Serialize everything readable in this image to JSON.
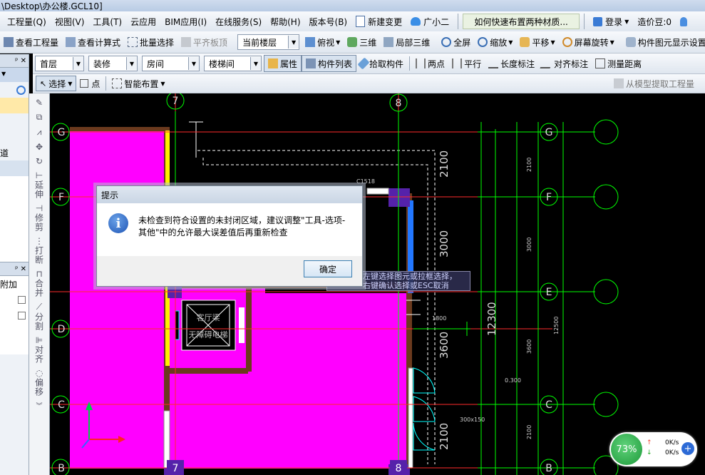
{
  "title_bar": {
    "path": "\\Desktop\\办公楼.GCL10]"
  },
  "menu": {
    "items": [
      "工程量(Q)",
      "视图(V)",
      "工具(T)",
      "云应用",
      "BIM应用(I)",
      "在线服务(S)",
      "帮助(H)",
      "版本号(B)",
      "新建变更",
      "广小二"
    ],
    "news": "如何快速布置两种材质...",
    "login": "登录",
    "beans": "造价豆:0"
  },
  "toolbar1": {
    "items": [
      "查看工程量",
      "查看计算式",
      "批量选择",
      "平齐板顶"
    ],
    "floor_select": "当前楼层",
    "view_items": [
      "俯视",
      "三维",
      "局部三维",
      "全屏",
      "缩放",
      "平移",
      "屏幕旋转",
      "构件图元显示设置"
    ]
  },
  "toolbar2": {
    "floor": "首层",
    "category": "装修",
    "type": "房间",
    "component": "楼梯间",
    "items": [
      "属性",
      "构件列表",
      "拾取构件",
      "两点",
      "平行",
      "长度标注",
      "对齐标注",
      "测量距离"
    ]
  },
  "toolbar3": {
    "select": "选择",
    "point": "点",
    "smart": "智能布置",
    "extract": "从模型提取工程量"
  },
  "left_panel": {
    "item1": "道",
    "item2": "附加"
  },
  "vertical_tools": [
    "延伸",
    "修剪",
    "打断",
    "合并",
    "分割",
    "对齐",
    "偏移"
  ],
  "canvas": {
    "axes_top": [
      "7",
      "8"
    ],
    "axes_left": [
      "G",
      "F",
      "D",
      "C",
      "B"
    ],
    "axes_right": [
      "G",
      "F",
      "E",
      "C",
      "B"
    ],
    "axes_bottom": [
      "7",
      "8"
    ],
    "dims_big": [
      "2100",
      "3000",
      "3600",
      "2100",
      "12300"
    ],
    "dims_small": [
      "2100",
      "3000",
      "12500",
      "3600",
      "2100"
    ],
    "labels": {
      "window": "C1518",
      "room1": "客厅梁",
      "room2": "无障碍电梯",
      "d1800": "1800",
      "d0300": "0.300",
      "beam": "300x150"
    }
  },
  "dialog": {
    "title": "提示",
    "message": "未检查到符合设置的未封闭区域，建议调整\"工具-选项-其他\"中的允许最大误差值后再重新检查",
    "ok_label": "确定"
  },
  "tooltip": {
    "line1": "左键选择图元或拉框选择，",
    "line2": "右键确认选择或ESC取消"
  },
  "net_widget": {
    "percent": "73%",
    "up": "0K/s",
    "down": "0K/s"
  },
  "colors": {
    "room_fill": "#ff00ff",
    "axis": "#00ff00",
    "wall": "#6b3a1e"
  }
}
